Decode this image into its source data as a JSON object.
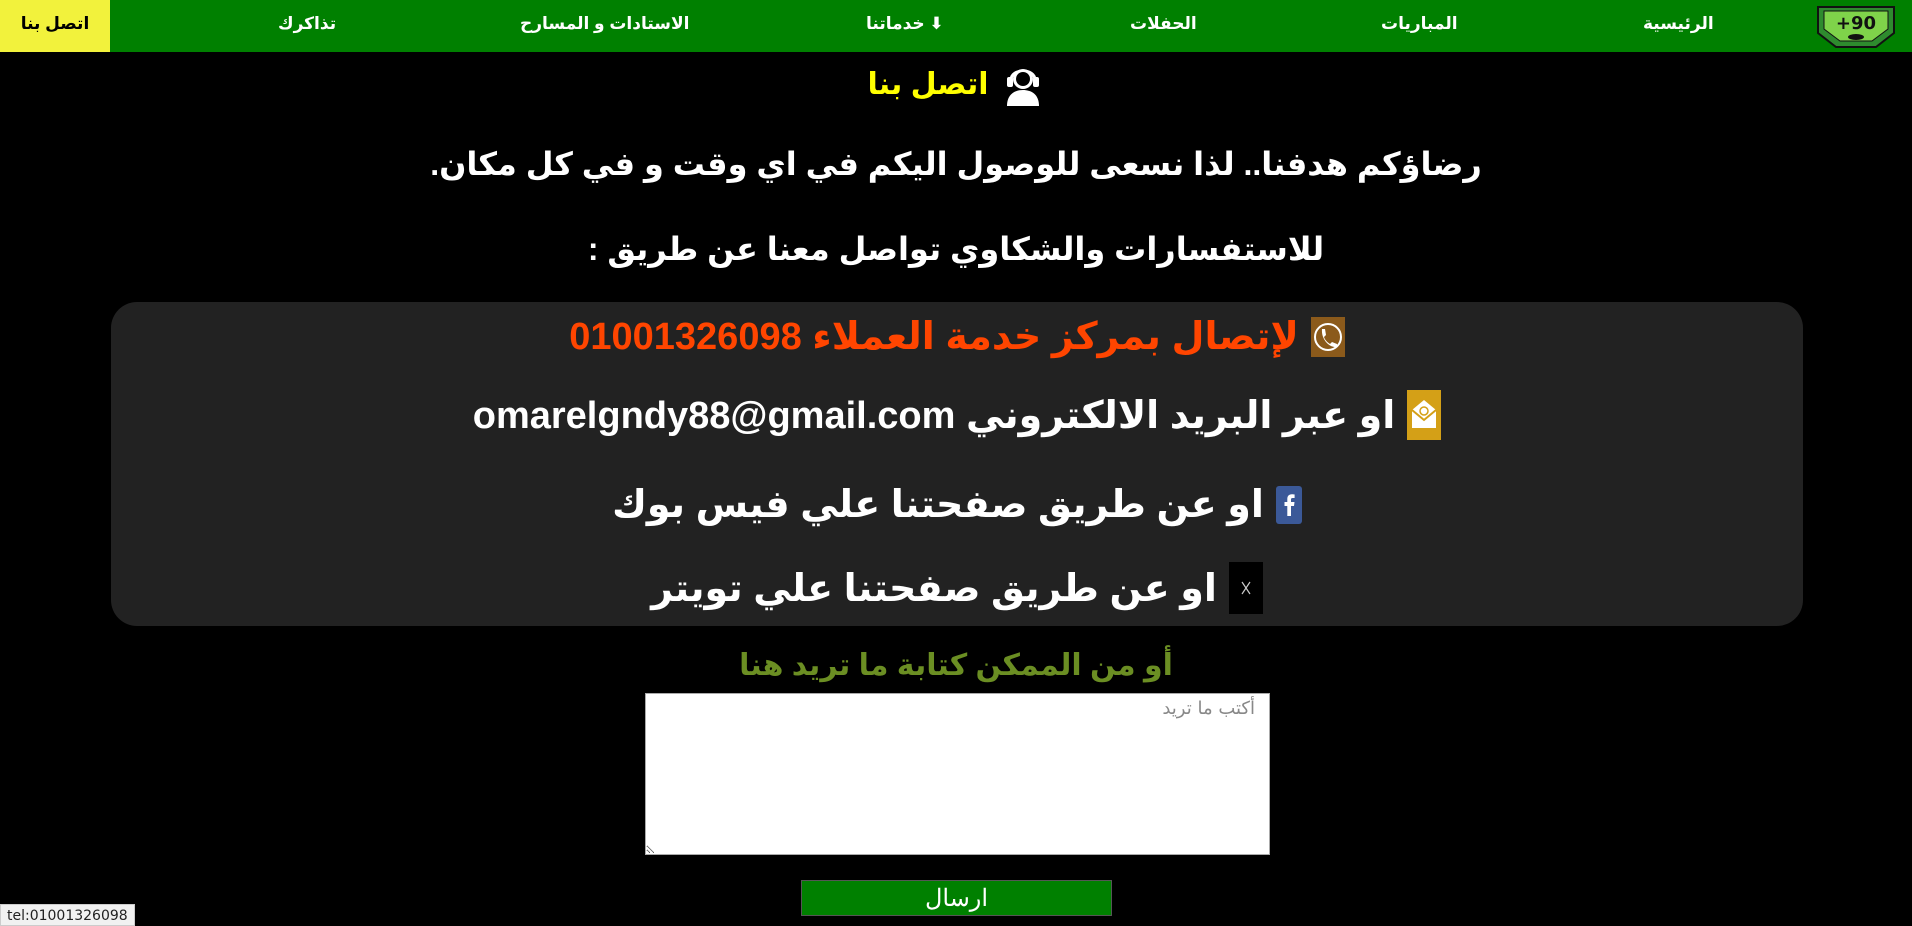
{
  "nav": {
    "contact": "اتصل بنا",
    "tickets": "تذاكرك",
    "stadiums": "الاستادات و المسارح",
    "services": "خدماتنا ⬇",
    "concerts": "الحفلات",
    "matches": "المباريات",
    "home": "الرئيسية",
    "logo_text": "+90",
    "accent": "#008000",
    "active_bg": "#f2f23c"
  },
  "header": {
    "title": "اتصل بنا",
    "title_icon": "headset-support-icon",
    "tagline": "رضاؤكم هدفنا.. لذا نسعى للوصول اليكم في اي وقت و في كل مكان.",
    "subtitle": "للاستفسارات والشكاوي تواصل معنا عن طريق :"
  },
  "contact": {
    "phone_text": "لإتصال بمركز خدمة العملاء 01001326098",
    "email_text": "او عبر البريد الالكتروني omarelgndy88@gmail.com",
    "facebook_text": "او عن طريق صفحتنا علي فيس بوك",
    "twitter_text": "او عن طريق صفحتنا علي تويتر",
    "phone_color": "#ff4500"
  },
  "form": {
    "hint": "أو من الممكن كتابة ما تريد هنا",
    "placeholder": "أكتب ما تريد",
    "submit": "ارسال"
  },
  "status_bar": "tel:01001326098"
}
